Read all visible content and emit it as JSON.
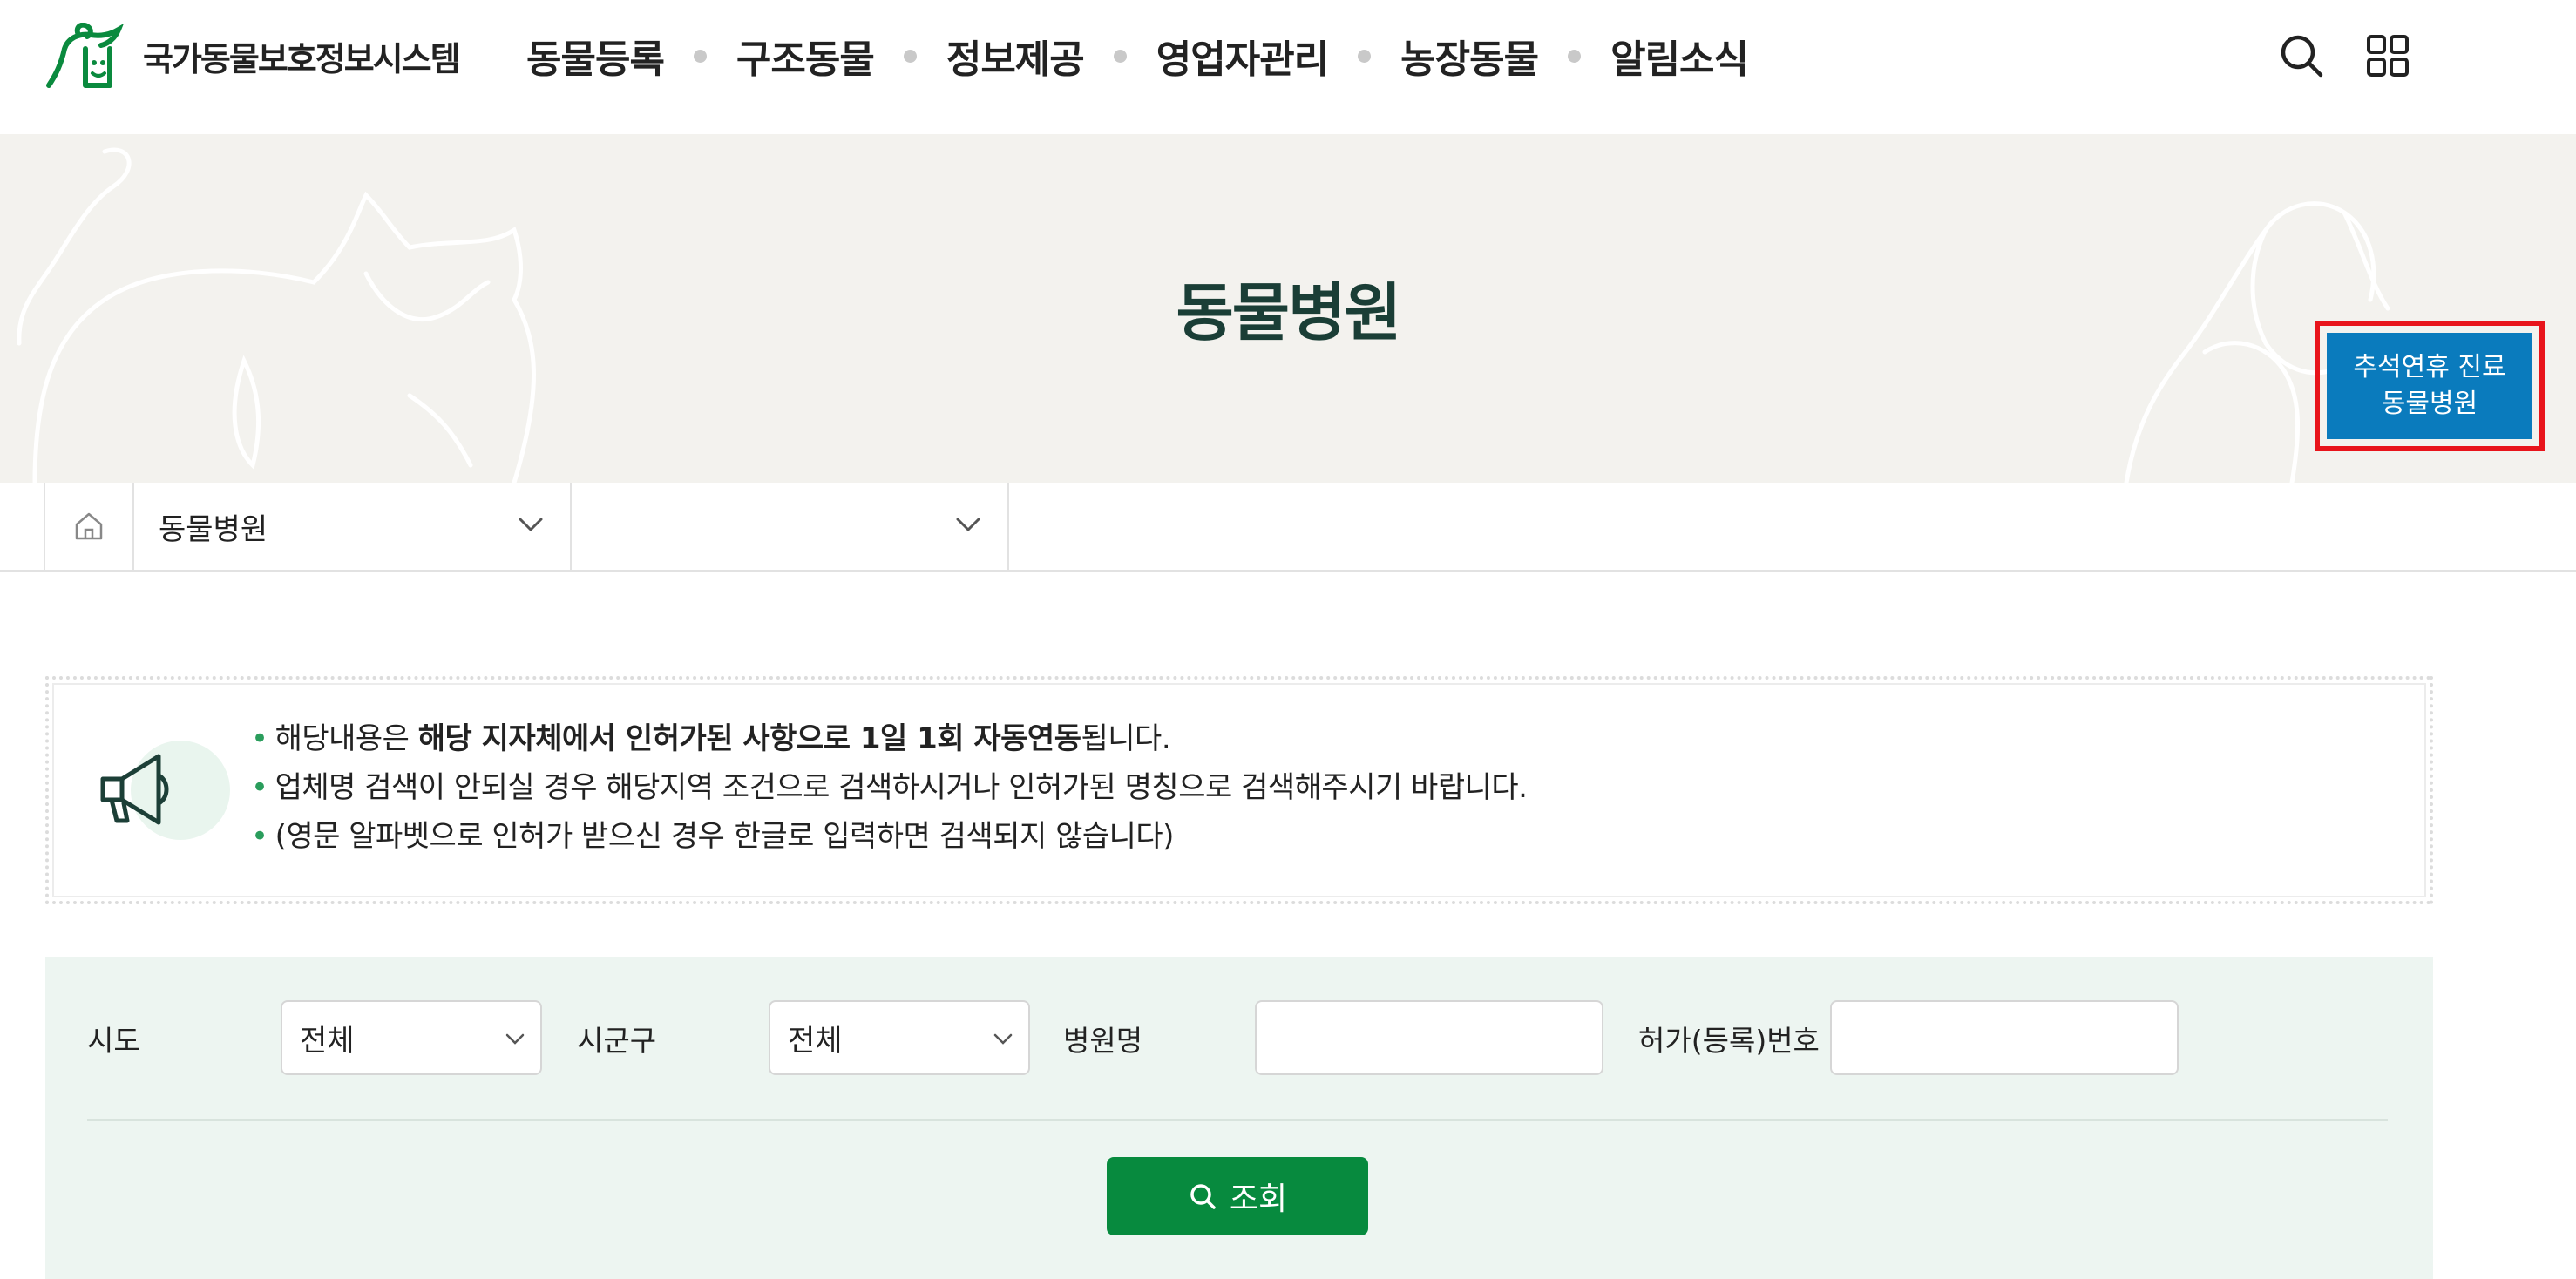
{
  "header": {
    "logo_text": "국가동물보호정보시스템",
    "nav": [
      "동물등록",
      "구조동물",
      "정보제공",
      "영업자관리",
      "농장동물",
      "알림소식"
    ]
  },
  "visual": {
    "page_title": "동물병원",
    "holiday_button": {
      "line1": "추석연휴 진료",
      "line2": "동물병원"
    }
  },
  "location": {
    "depth1": "동물병원",
    "depth2": ""
  },
  "notice": {
    "line1_pre": "해당내용은 ",
    "line1_bold": "해당 지자체에서 인허가된 사항으로 1일 1회 자동연동",
    "line1_post": "됩니다.",
    "line2": "업체명 검색이 안되실 경우 해당지역 조건으로 검색하시거나 인허가된 명칭으로 검색해주시기 바랍니다.",
    "line3": "(영문 알파벳으로 인허가 받으신 경우 한글로 입력하면 검색되지 않습니다)"
  },
  "search": {
    "sido_label": "시도",
    "sido_value": "전체",
    "sigungu_label": "시군구",
    "sigungu_value": "전체",
    "hospital_label": "병원명",
    "hospital_value": "",
    "license_label": "허가(등록)번호",
    "license_value": "",
    "submit_label": "조회"
  },
  "colors": {
    "brand_green": "#078a3e",
    "title_dark_green": "#1a3e36",
    "holiday_blue": "#0a7bbd",
    "highlight_red": "#e8141b",
    "banner_bg": "#f3f2ee",
    "search_bg": "#edf5f1"
  },
  "icons": [
    "logo-mark-icon",
    "search-icon",
    "all-menu-icon",
    "home-icon",
    "chevron-down-icon",
    "megaphone-icon"
  ]
}
